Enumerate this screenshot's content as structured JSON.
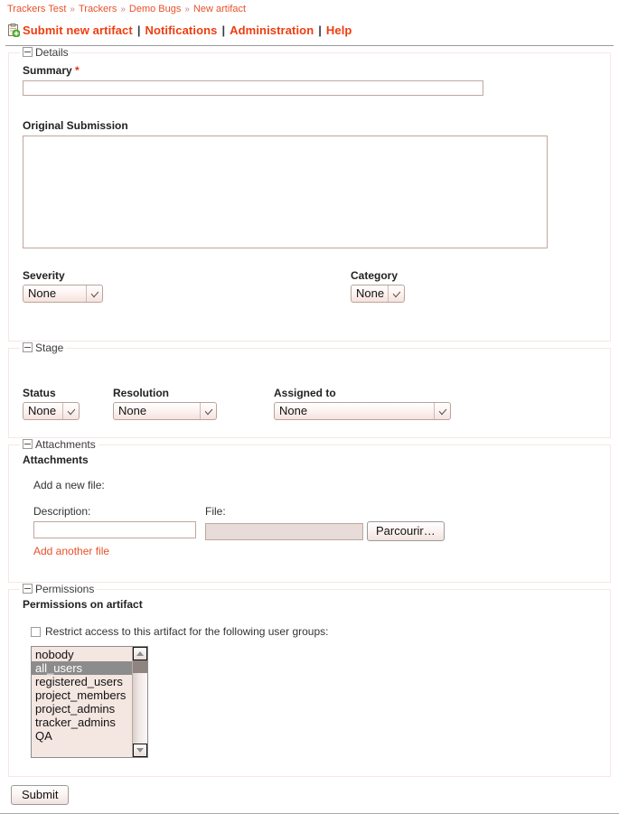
{
  "breadcrumb": {
    "separator": "»",
    "items": [
      {
        "label": "Trackers Test"
      },
      {
        "label": "Trackers"
      },
      {
        "label": "Demo Bugs"
      },
      {
        "label": "New artifact"
      }
    ]
  },
  "toolbar": {
    "icon": "new-artifact-clipboard-icon",
    "separator": "|",
    "items": [
      {
        "label": "Submit new artifact"
      },
      {
        "label": "Notifications"
      },
      {
        "label": "Administration"
      },
      {
        "label": "Help"
      }
    ]
  },
  "details": {
    "legend": "Details",
    "summary_label": "Summary",
    "summary_required_mark": "*",
    "summary_value": "",
    "original_submission_label": "Original Submission",
    "original_submission_value": "",
    "severity": {
      "label": "Severity",
      "value": "None",
      "options": [
        "None"
      ]
    },
    "category": {
      "label": "Category",
      "value": "None",
      "options": [
        "None"
      ]
    }
  },
  "stage": {
    "legend": "Stage",
    "status": {
      "label": "Status",
      "value": "None",
      "options": [
        "None"
      ]
    },
    "resolution": {
      "label": "Resolution",
      "value": "None",
      "options": [
        "None"
      ]
    },
    "assigned_to": {
      "label": "Assigned to",
      "value": "None",
      "options": [
        "None"
      ]
    }
  },
  "attachments": {
    "legend": "Attachments",
    "heading": "Attachments",
    "add_new_file_label": "Add a new file:",
    "description_label": "Description:",
    "description_value": "",
    "file_label": "File:",
    "file_value": "",
    "browse_button": "Parcourir…",
    "add_another_file_link": "Add another file"
  },
  "permissions": {
    "legend": "Permissions",
    "heading": "Permissions on artifact",
    "restrict_checkbox_label": "Restrict access to this artifact for the following user groups:",
    "restrict_checked": false,
    "user_groups": [
      {
        "label": "nobody",
        "selected": false
      },
      {
        "label": "all_users",
        "selected": true
      },
      {
        "label": "registered_users",
        "selected": false
      },
      {
        "label": "project_members",
        "selected": false
      },
      {
        "label": "project_admins",
        "selected": false
      },
      {
        "label": "tracker_admins",
        "selected": false
      },
      {
        "label": "QA",
        "selected": false
      }
    ]
  },
  "footer": {
    "submit_label": "Submit"
  },
  "colors": {
    "link_orange": "#e8512a",
    "toolbar_orange": "#ef3d10",
    "required_red": "#e0301e",
    "fieldset_border": "#f6e7e3",
    "input_border": "#bfa79f",
    "listbox_bg": "#f4e6e1",
    "selected_option_bg": "#8c8c8c"
  }
}
